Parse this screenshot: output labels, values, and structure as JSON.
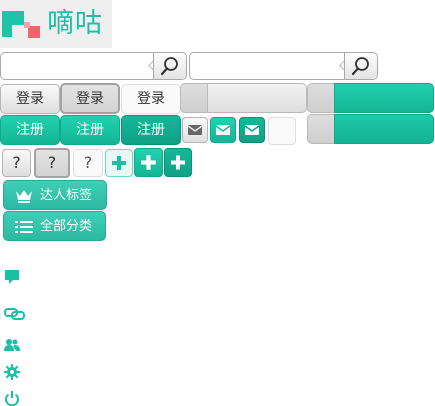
{
  "logo": {
    "text": "嘀咕"
  },
  "search": [
    {
      "value": "",
      "placeholder": ""
    },
    {
      "value": "",
      "placeholder": ""
    }
  ],
  "buttons": {
    "login": [
      "登录",
      "登录",
      "登录"
    ],
    "register": [
      "注册",
      "注册",
      "注册"
    ],
    "help": [
      "?",
      "?",
      "?"
    ]
  },
  "tags": {
    "talent": "达人标签",
    "all_categories": "全部分类"
  },
  "sidebar_icons": [
    "comment-icon",
    "link-icon",
    "users-icon",
    "gear-icon",
    "power-icon"
  ],
  "colors": {
    "accent": "#19c0a6",
    "accent_dark": "#0fa186",
    "gray": "#d8d8d8"
  }
}
